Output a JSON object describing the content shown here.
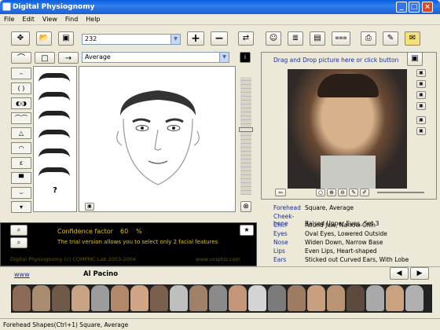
{
  "window": {
    "title": "Digital Physiognomy",
    "min": "_",
    "max": "□",
    "close": "×"
  },
  "menu": [
    "File",
    "Edit",
    "View",
    "Find",
    "Help"
  ],
  "toolbar": {
    "combo_value": "232",
    "plus": "+",
    "minus": "−"
  },
  "left": {
    "feature_combo": "Average",
    "question": "?"
  },
  "right": {
    "instruction": "Drag and Drop picture here or click button"
  },
  "info": {
    "confidence_label": "Confidence factor",
    "confidence_value": "60",
    "confidence_unit": "%",
    "trial_note": "The trial version allows you to select only 2 facial features",
    "footer_left": "Digital Physiognomy (c) COMPMC Lab 2003-2004",
    "footer_right": "www.uniphiz.com"
  },
  "characteristics": [
    {
      "k": "Forehead",
      "v": "Square, Average"
    },
    {
      "k": "Cheek-bone",
      "v": "Raised Upper Eyes, Set  3"
    },
    {
      "k": "Chin",
      "v": "Round Jaw, Narrow Chin"
    },
    {
      "k": "Eyes",
      "v": "Oval Eyes, Lowered Outside"
    },
    {
      "k": "Nose",
      "v": "Widen Down, Narrow Base"
    },
    {
      "k": "Lips",
      "v": "Even Lips, Heart-shaped"
    },
    {
      "k": "Ears",
      "v": "Sticked out Curved Ears, With Lobe"
    }
  ],
  "gallery": {
    "link": "www",
    "name": "Al Pacino",
    "prev": "◀",
    "next": "▶"
  },
  "status": "Forehead Shapes(Ctrl+1) Square, Average",
  "colors": {
    "title": "#0a5ddc",
    "accent_yellow": "#e6c200",
    "link": "#1b2e9c"
  }
}
